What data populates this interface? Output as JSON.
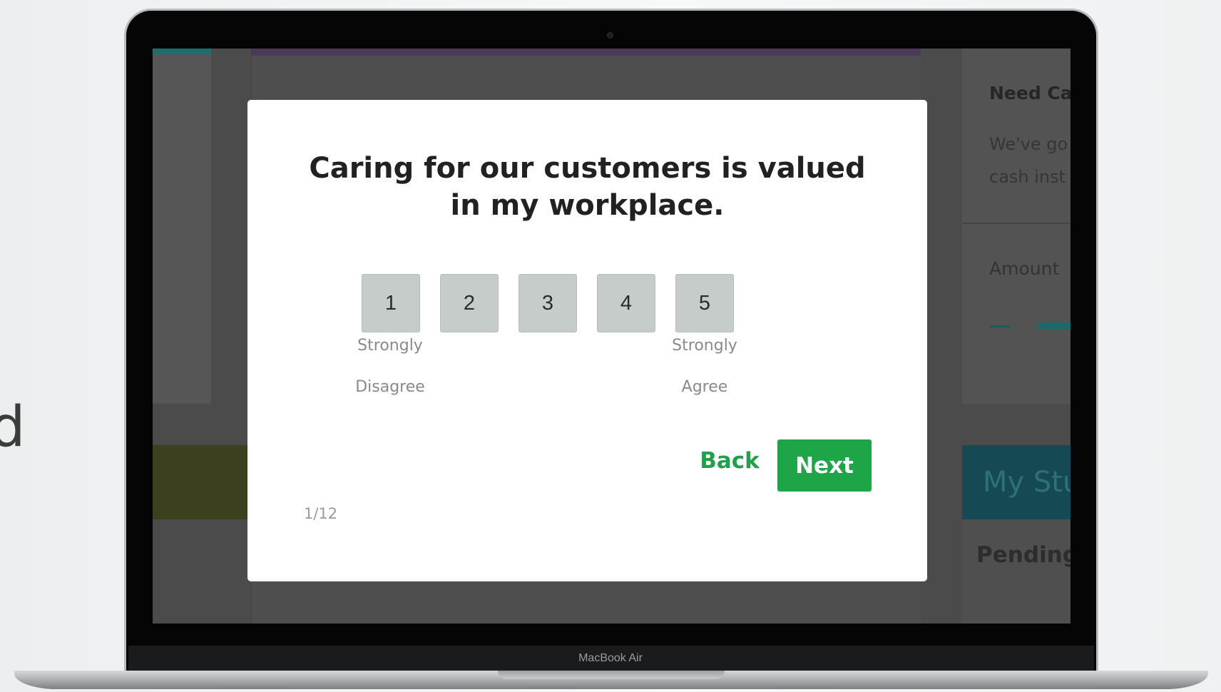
{
  "page": {
    "edge_text": "d"
  },
  "device": {
    "model_label": "MacBook Air"
  },
  "background_page": {
    "sidebar_heading": "Need Ca",
    "sidebar_body_line1": "We've go",
    "sidebar_body_line2": "cash inst",
    "amount_label": "Amount",
    "banner_title": "My Stu",
    "pending_label": "Pending I"
  },
  "survey_modal": {
    "question": "Caring for our customers is valued in my workplace.",
    "scale": [
      {
        "value": "1",
        "label_top": "Strongly",
        "label_bottom": "Disagree"
      },
      {
        "value": "2"
      },
      {
        "value": "3"
      },
      {
        "value": "4"
      },
      {
        "value": "5",
        "label_top": "Strongly",
        "label_bottom": "Agree"
      }
    ],
    "back_label": "Back",
    "next_label": "Next",
    "progress": "1/12",
    "accent_color": "#1ea548",
    "scale_button_color": "#c6ccca"
  }
}
